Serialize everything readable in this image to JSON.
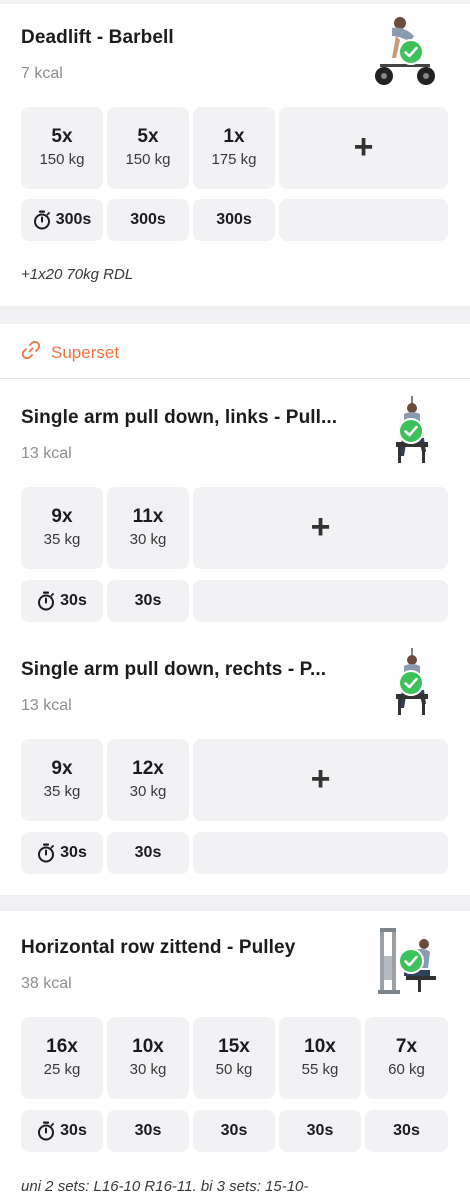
{
  "colors": {
    "accent": "#f0733e",
    "check": "#3cc25a",
    "cell_bg": "#f2f2f4",
    "section_bg": "#f0f0f2"
  },
  "icons": {
    "timer": "stopwatch-icon",
    "add": "plus-icon",
    "done": "checkmark-icon",
    "link": "link-icon"
  },
  "exercise1": {
    "title": "Deadlift - Barbell",
    "kcal": "7 kcal",
    "sets": [
      {
        "reps": "5x",
        "weight": "150 kg"
      },
      {
        "reps": "5x",
        "weight": "150 kg"
      },
      {
        "reps": "1x",
        "weight": "175 kg"
      }
    ],
    "add_label": "+",
    "rests": [
      "300s",
      "300s",
      "300s"
    ],
    "note": "+1x20 70kg RDL"
  },
  "superset": {
    "label": "Superset"
  },
  "exercise2": {
    "title": "Single arm pull down, links - Pull...",
    "kcal": "13 kcal",
    "sets": [
      {
        "reps": "9x",
        "weight": "35 kg"
      },
      {
        "reps": "11x",
        "weight": "30 kg"
      }
    ],
    "add_label": "+",
    "rests": [
      "30s",
      "30s"
    ]
  },
  "exercise3": {
    "title": "Single arm pull down, rechts - P...",
    "kcal": "13 kcal",
    "sets": [
      {
        "reps": "9x",
        "weight": "35 kg"
      },
      {
        "reps": "12x",
        "weight": "30 kg"
      }
    ],
    "add_label": "+",
    "rests": [
      "30s",
      "30s"
    ]
  },
  "exercise4": {
    "title": "Horizontal row zittend - Pulley",
    "kcal": "38 kcal",
    "sets": [
      {
        "reps": "16x",
        "weight": "25 kg"
      },
      {
        "reps": "10x",
        "weight": "30 kg"
      },
      {
        "reps": "15x",
        "weight": "50 kg"
      },
      {
        "reps": "10x",
        "weight": "55 kg"
      },
      {
        "reps": "7x",
        "weight": "60 kg"
      }
    ],
    "rests": [
      "30s",
      "30s",
      "30s",
      "30s",
      "30s"
    ],
    "note": "uni 2 sets: L16-10 R16-11. bi 3 sets: 15-10-"
  }
}
